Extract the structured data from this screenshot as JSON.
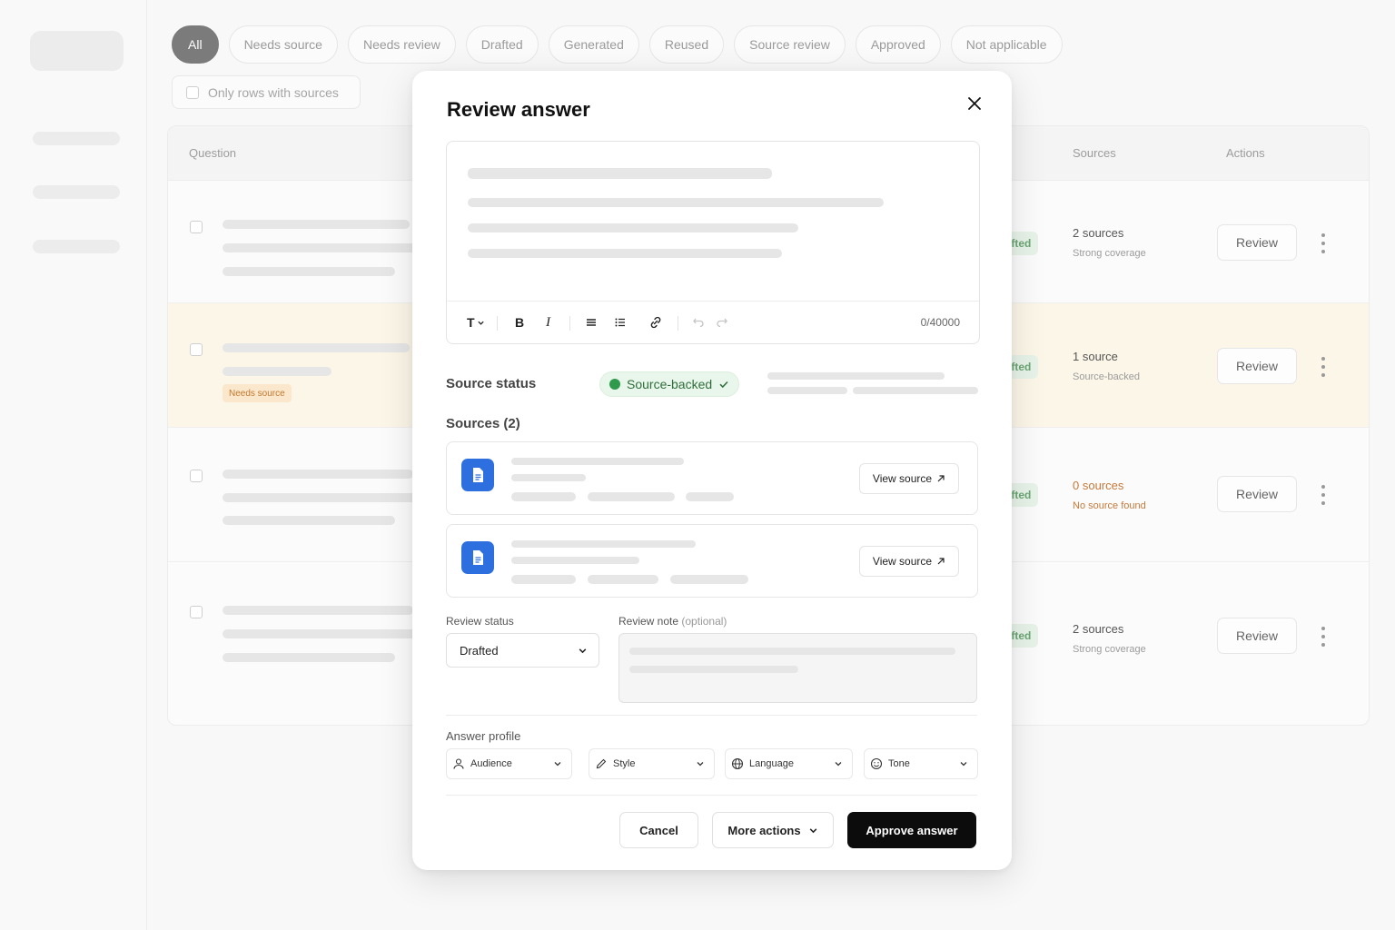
{
  "filters": {
    "chips": [
      {
        "label": "All",
        "active": true
      },
      {
        "label": "Needs source"
      },
      {
        "label": "Needs review"
      },
      {
        "label": "Drafted"
      },
      {
        "label": "Generated"
      },
      {
        "label": "Reused"
      },
      {
        "label": "Source review"
      },
      {
        "label": "Approved"
      },
      {
        "label": "Not applicable"
      }
    ],
    "only_rows_label": "Only rows with sources"
  },
  "table": {
    "headers": {
      "question": "Question",
      "sources": "Sources",
      "actions": "Actions"
    },
    "rows": [
      {
        "status": "rafted",
        "sources": "2 sources",
        "coverage": "Strong coverage",
        "review": "Review"
      },
      {
        "status": "rafted",
        "sources": "1 source",
        "coverage": "Source-backed",
        "review": "Review",
        "badge": "Needs source"
      },
      {
        "status": "rafted",
        "sources": "0 sources",
        "coverage": "No source found",
        "review": "Review"
      },
      {
        "status": "rafted",
        "sources": "2 sources",
        "coverage": "Strong coverage",
        "review": "Review"
      }
    ]
  },
  "modal": {
    "title": "Review answer",
    "editor": {
      "text_style": "T",
      "bold": "B",
      "italic": "I",
      "char_count": "0/40000"
    },
    "source_status": {
      "label": "Source status",
      "value": "Source-backed"
    },
    "sources": {
      "heading": "Sources (2)",
      "cards": [
        {
          "action": "View source"
        },
        {
          "action": "View source"
        }
      ]
    },
    "review_status": {
      "label": "Review status",
      "value": "Drafted"
    },
    "review_note": {
      "label": "Review note",
      "optional": "(optional)"
    },
    "answer_profile": {
      "label": "Answer profile",
      "fields": {
        "audience": "Audience",
        "style": "Style",
        "language": "Language",
        "tone": "Tone"
      }
    },
    "buttons": {
      "cancel": "Cancel",
      "more": "More actions",
      "approve": "Approve answer"
    }
  },
  "colors": {
    "accent": "#0c0c0c",
    "success": "#2f9a4b",
    "doc_icon": "#2e6fe0",
    "warning": "#c7793a"
  }
}
